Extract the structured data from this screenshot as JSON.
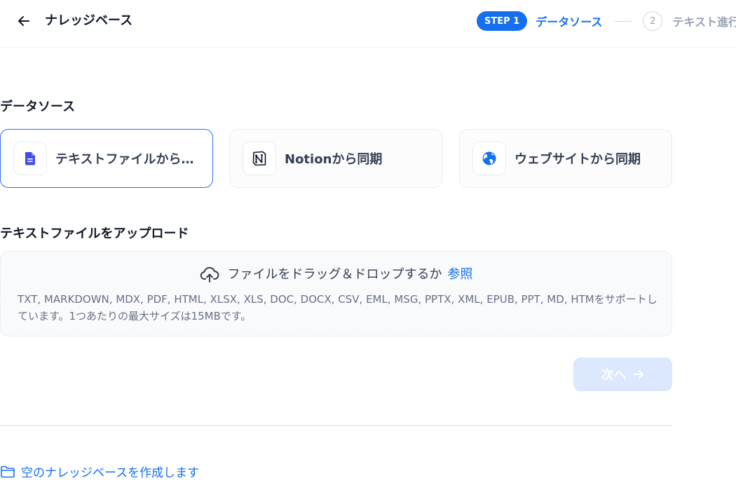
{
  "header": {
    "title": "ナレッジベース",
    "back_icon": "arrow-left-icon"
  },
  "stepper": {
    "step1_badge": "STEP 1",
    "step1_label": "データソース",
    "step2_number": "2",
    "step2_label": "テキスト進行中"
  },
  "data_source": {
    "title": "データソース",
    "options": [
      {
        "label": "テキストファイルからインポート",
        "icon": "document-icon",
        "selected": true
      },
      {
        "label": "Notionから同期",
        "icon": "notion-logo-icon",
        "selected": false
      },
      {
        "label": "ウェブサイトから同期",
        "icon": "globe-icon",
        "selected": false
      }
    ]
  },
  "upload": {
    "title": "テキストファイルをアップロード",
    "drop_text": "ファイルをドラッグ＆ドロップするか",
    "browse_link": "参照",
    "supported_text": "TXT, MARKDOWN, MDX, PDF, HTML, XLSX, XLS, DOC, DOCX, CSV, EML, MSG, PPTX, XML, EPUB, PPT, MD, HTMをサポートしています。1つあたりの最大サイズは15MBです。"
  },
  "next_button": {
    "label": "次へ"
  },
  "create_empty": {
    "label": "空のナレッジベースを作成します"
  },
  "colors": {
    "accent": "#1570ef",
    "selected_border": "#2e6ee8",
    "disabled_button": "#dbe8fe"
  }
}
